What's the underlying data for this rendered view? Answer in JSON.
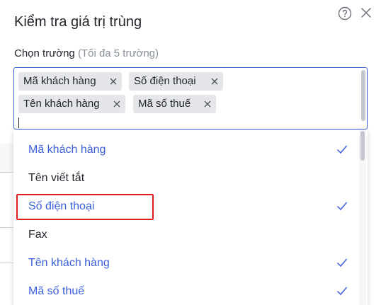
{
  "dialog": {
    "title": "Kiểm tra giá trị trùng",
    "field_label": "Chọn trường",
    "field_hint": "(Tối đa 5 trường)"
  },
  "selected_tags": [
    {
      "label": "Mã khách hàng"
    },
    {
      "label": "Số điện thoại"
    },
    {
      "label": "Tên khách hàng"
    },
    {
      "label": "Mã số thuế"
    }
  ],
  "options": [
    {
      "label": "Mã khách hàng",
      "selected": true
    },
    {
      "label": "Tên viết tắt",
      "selected": false
    },
    {
      "label": "Số điện thoại",
      "selected": true
    },
    {
      "label": "Fax",
      "selected": false
    },
    {
      "label": "Tên khách hàng",
      "selected": true
    },
    {
      "label": "Mã số thuế",
      "selected": true
    }
  ],
  "colors": {
    "accent": "#3b5fd9",
    "highlight": "#e01e1e",
    "tag_bg": "#e4e6ea"
  }
}
